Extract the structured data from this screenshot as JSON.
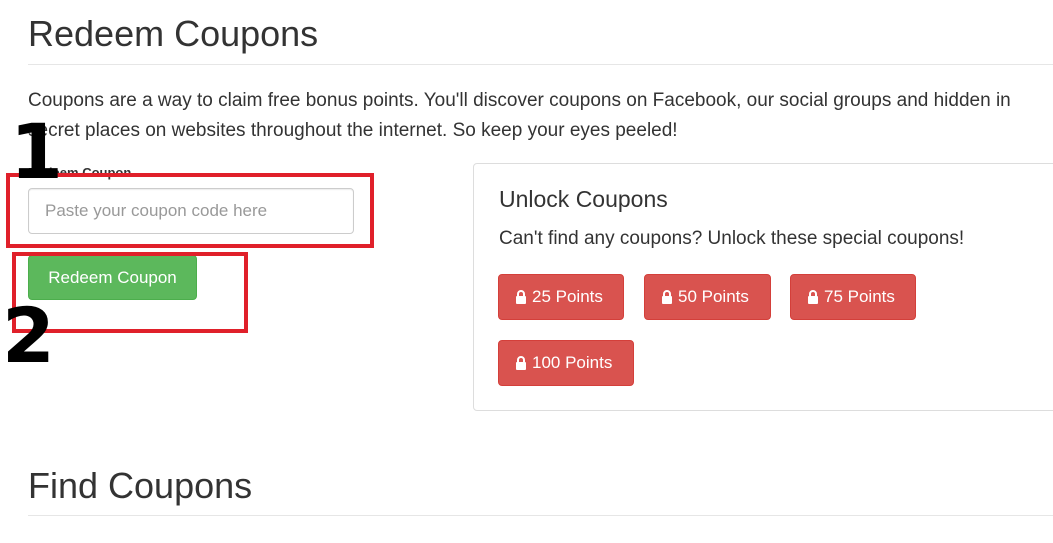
{
  "page": {
    "title": "Redeem Coupons",
    "intro": "Coupons are a way to claim free bonus points. You'll discover coupons on Facebook, our social groups and hidden in secret places on websites throughout the internet. So keep your eyes peeled!"
  },
  "redeem_form": {
    "label": "Redeem Coupon",
    "input_placeholder": "Paste your coupon code here",
    "input_value": "",
    "button_label": "Redeem Coupon",
    "button_color": "#5cb85c"
  },
  "annotations": {
    "step_one": "1",
    "step_two": "2",
    "box_color": "#e0202a"
  },
  "unlock_panel": {
    "title": "Unlock Coupons",
    "text": "Can't find any coupons? Unlock these special coupons!",
    "button_color": "#d9534f",
    "button_icon": "lock-icon",
    "buttons": [
      {
        "label": "25 Points"
      },
      {
        "label": "50 Points"
      },
      {
        "label": "75 Points"
      },
      {
        "label": "100 Points"
      }
    ]
  },
  "find_section": {
    "title": "Find Coupons"
  }
}
